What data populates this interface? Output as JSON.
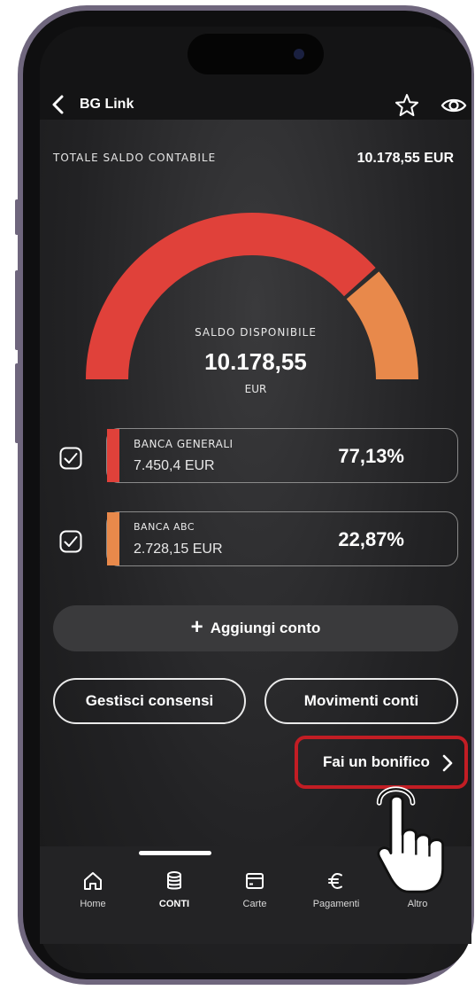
{
  "header": {
    "title": "BG Link"
  },
  "summary": {
    "total_label": "TOTALE SALDO CONTABILE",
    "total_value": "10.178,55 EUR"
  },
  "gauge": {
    "label": "SALDO DISPONIBILE",
    "value": "10.178,55",
    "currency": "EUR",
    "segments": [
      {
        "share": 0.7713,
        "color": "#e0413a"
      },
      {
        "share": 0.2287,
        "color": "#e8894b"
      }
    ]
  },
  "accounts": [
    {
      "name": "BANCA GENERALI",
      "amount": "7.450,4 EUR",
      "percent": "77,13%",
      "color": "#e0413a",
      "checked": true
    },
    {
      "name": "BANCA ABC",
      "amount": "2.728,15 EUR",
      "percent": "22,87%",
      "color": "#e8894b",
      "checked": true
    }
  ],
  "actions": {
    "add_account": "Aggiungi conto",
    "manage_consents": "Gestisci consensi",
    "account_movements": "Movimenti conti",
    "transfer": "Fai un bonifico"
  },
  "tabbar": {
    "items": [
      {
        "label": "Home",
        "icon": "home-icon"
      },
      {
        "label": "CONTI",
        "icon": "database-icon",
        "active": true
      },
      {
        "label": "Carte",
        "icon": "card-icon"
      },
      {
        "label": "Pagamenti",
        "icon": "euro-icon"
      },
      {
        "label": "Altro",
        "icon": "menu-icon"
      }
    ]
  },
  "colors": {
    "accent_red": "#e0413a",
    "accent_orange": "#e8894b",
    "highlight": "#c21d24"
  }
}
